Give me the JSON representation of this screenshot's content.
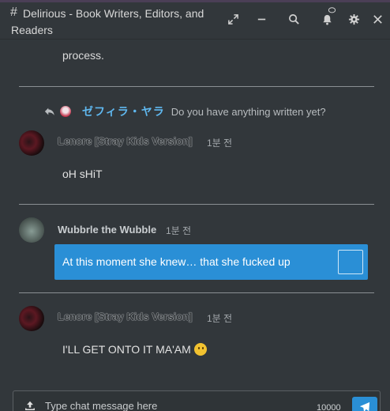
{
  "colors": {
    "accent": "#2a8fd6",
    "background": "#32373b",
    "reply_name": "#5fb7ee"
  },
  "header": {
    "title": "Delirious - Book Writers, Editors, and Readers",
    "icons": [
      "expand-icon",
      "minimize-icon",
      "search-icon",
      "bell-icon",
      "gear-icon",
      "close-icon"
    ]
  },
  "previous_message": {
    "text": "process."
  },
  "reply": {
    "name": "ゼフィラ・ヤラ",
    "text": "Do you have anything written yet?"
  },
  "messages": [
    {
      "author": "Lenore [Stray Kids Version]",
      "time": "1분 전",
      "text": "oH sHiT"
    },
    {
      "author": "Wubbrle the Wubble",
      "time": "1분 전",
      "text": "At this moment she knew… that she fucked up"
    },
    {
      "author": "Lenore [Stray Kids Version]",
      "time": "1분 전",
      "text": "I'LL GET ONTO IT MA'AM"
    }
  ],
  "composer": {
    "placeholder": "Type chat message here",
    "char_limit": "10000"
  }
}
